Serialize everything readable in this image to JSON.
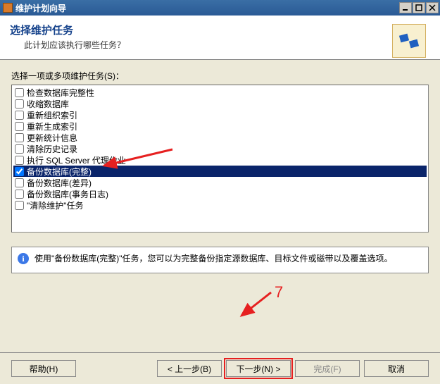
{
  "window": {
    "title": "维护计划向导"
  },
  "header": {
    "title": "选择维护任务",
    "subtitle": "此计划应该执行哪些任务？"
  },
  "body": {
    "prompt": "选择一项或多项维护任务(S)：",
    "items": [
      {
        "label": "检查数据库完整性",
        "checked": false,
        "selected": false
      },
      {
        "label": "收缩数据库",
        "checked": false,
        "selected": false
      },
      {
        "label": "重新组织索引",
        "checked": false,
        "selected": false
      },
      {
        "label": "重新生成索引",
        "checked": false,
        "selected": false
      },
      {
        "label": "更新统计信息",
        "checked": false,
        "selected": false
      },
      {
        "label": "清除历史记录",
        "checked": false,
        "selected": false
      },
      {
        "label": "执行 SQL Server 代理作业",
        "checked": false,
        "selected": false
      },
      {
        "label": "备份数据库(完整)",
        "checked": true,
        "selected": true
      },
      {
        "label": "备份数据库(差异)",
        "checked": false,
        "selected": false
      },
      {
        "label": "备份数据库(事务日志)",
        "checked": false,
        "selected": false
      },
      {
        "label": "\"清除维护\"任务",
        "checked": false,
        "selected": false
      }
    ],
    "description": "使用\"备份数据库(完整)\"任务，您可以为完整备份指定源数据库、目标文件或磁带以及覆盖选项。"
  },
  "annotation": {
    "label": "7"
  },
  "buttons": {
    "help": "帮助(H)",
    "back": "< 上一步(B)",
    "next": "下一步(N) >",
    "finish": "完成(F)",
    "cancel": "取消"
  }
}
